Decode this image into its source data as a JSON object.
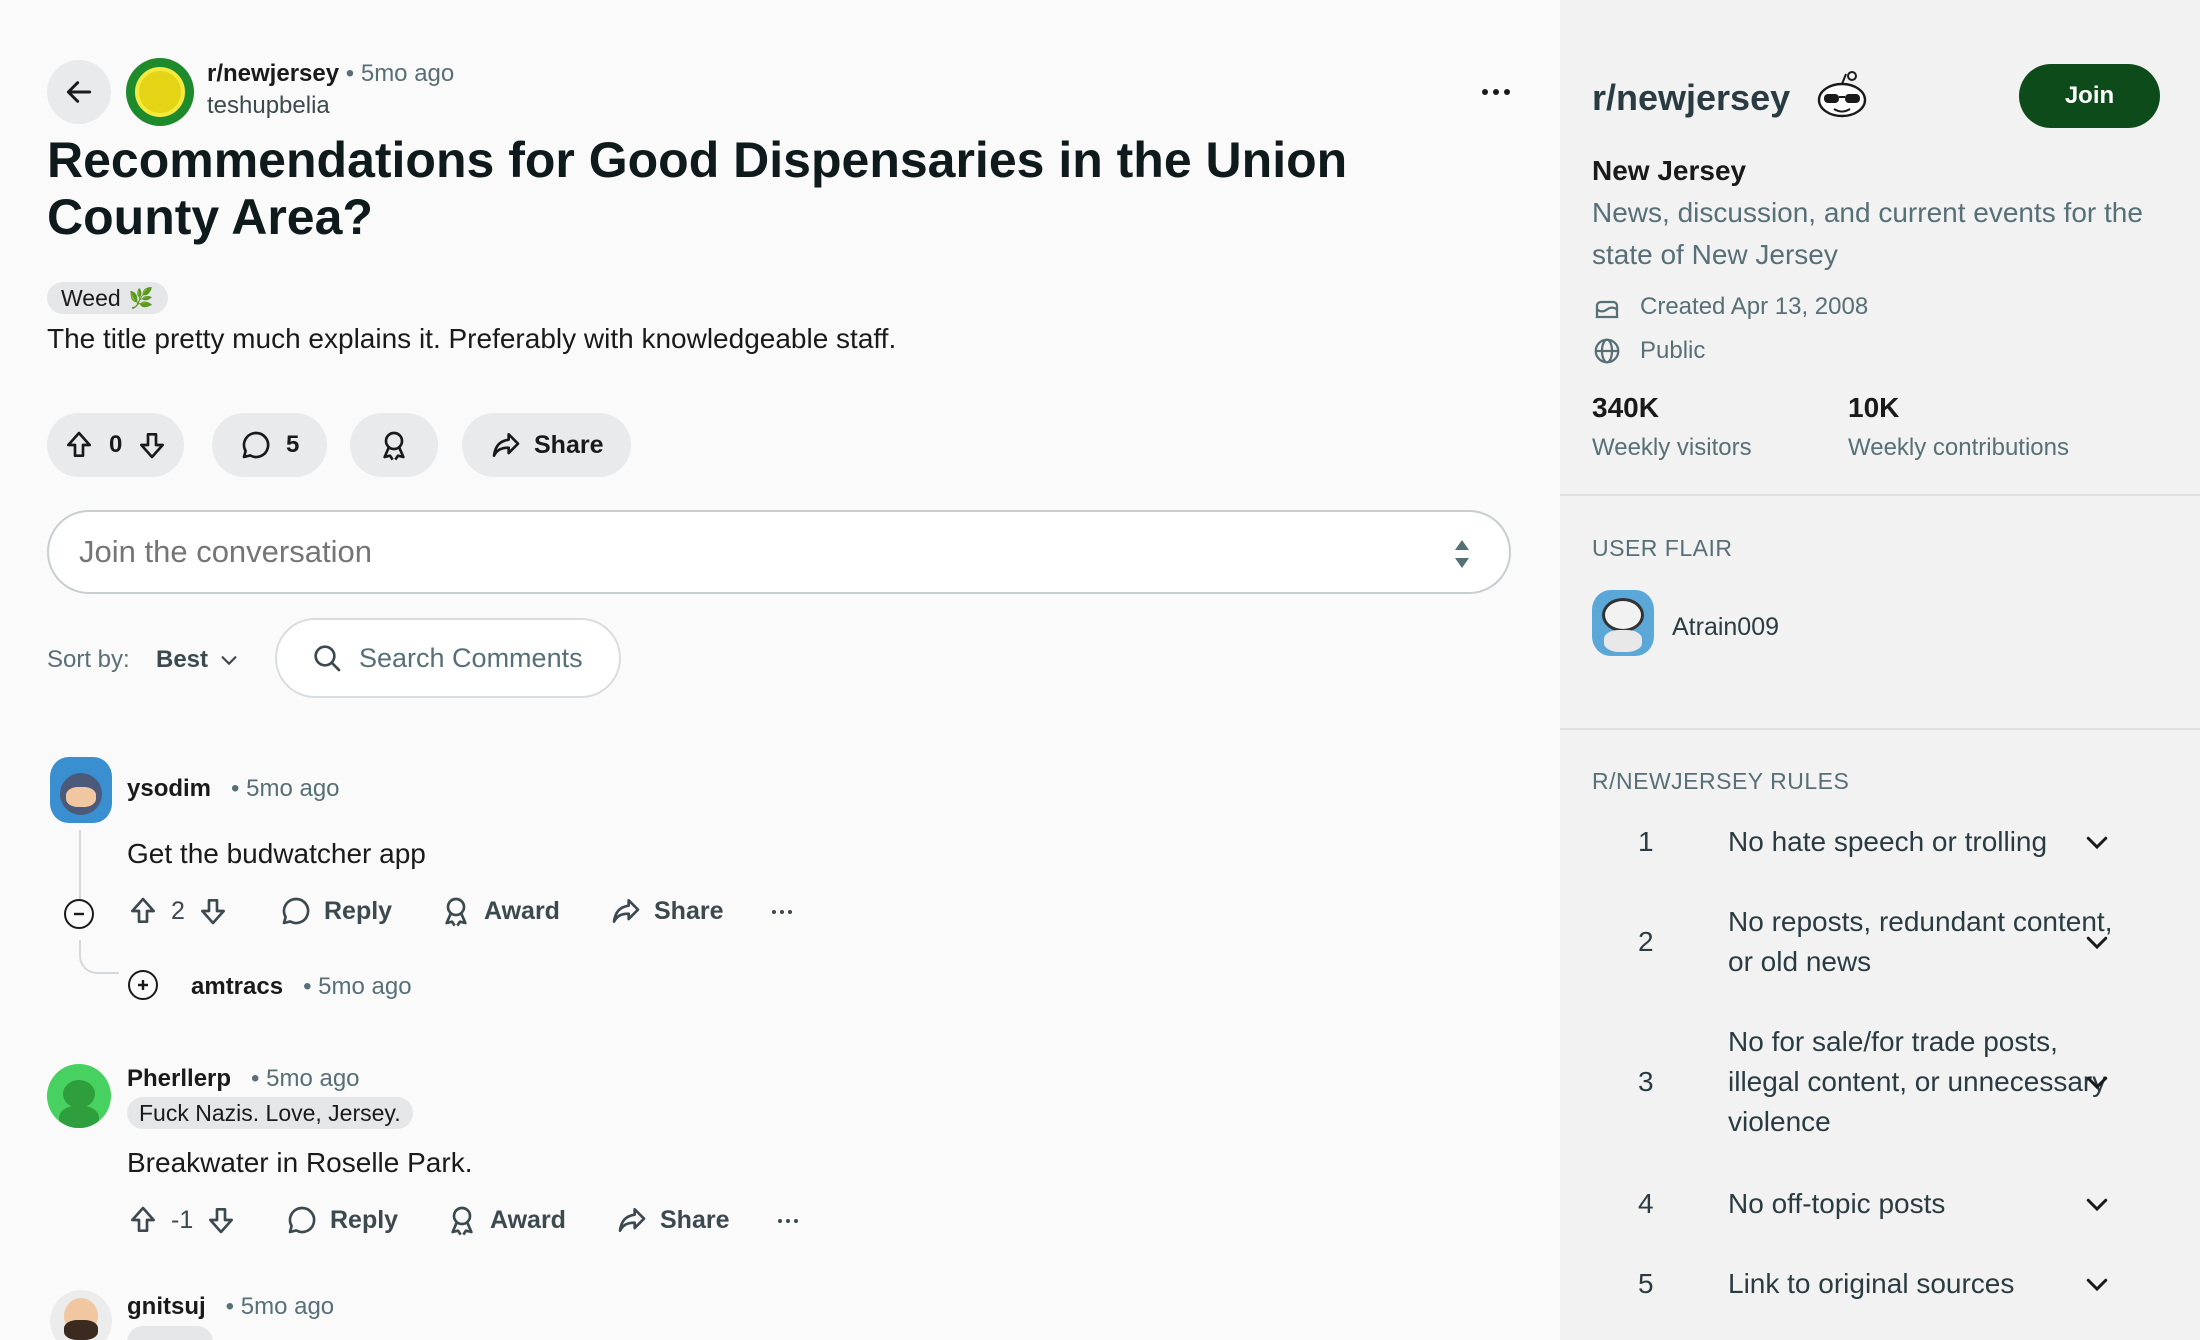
{
  "post": {
    "subreddit": "r/newjersey",
    "time": "5mo ago",
    "author": "teshupbelia",
    "title": "Recommendations for Good Dispensaries in the Union County Area?",
    "flair": "Weed",
    "body": "The title pretty much explains it. Preferably with knowledgeable staff.",
    "votes": "0",
    "comments": "5",
    "share_label": "Share"
  },
  "composer": {
    "placeholder": "Join the conversation"
  },
  "sort": {
    "label": "Sort by:",
    "value": "Best",
    "search_placeholder": "Search Comments"
  },
  "comments": [
    {
      "author": "ysodim",
      "time": "5mo ago",
      "text": "Get the budwatcher app",
      "votes": "2",
      "reply": "Reply",
      "award": "Award",
      "share": "Share"
    },
    {
      "author": "amtracs",
      "time": "5mo ago"
    },
    {
      "author": "Pherllerp",
      "time": "5mo ago",
      "flair": "Fuck Nazis. Love, Jersey.",
      "text": "Breakwater in Roselle Park.",
      "votes": "-1",
      "reply": "Reply",
      "award": "Award",
      "share": "Share"
    },
    {
      "author": "gnitsuj",
      "time": "5mo ago"
    }
  ],
  "sidebar": {
    "name": "r/newjersey",
    "join": "Join",
    "title": "New Jersey",
    "description": "News, discussion, and current events for the state of New Jersey",
    "created": "Created Apr 13, 2008",
    "visibility": "Public",
    "stats": [
      {
        "value": "340K",
        "label": "Weekly visitors"
      },
      {
        "value": "10K",
        "label": "Weekly contributions"
      }
    ],
    "user_flair_heading": "USER FLAIR",
    "user_flair_name": "Atrain009",
    "rules_heading": "R/NEWJERSEY RULES",
    "rules": [
      {
        "num": "1",
        "text": "No hate speech or trolling"
      },
      {
        "num": "2",
        "text": "No reposts, redundant content, or old news"
      },
      {
        "num": "3",
        "text": "No for sale/for trade posts, illegal content, or unnecessary violence"
      },
      {
        "num": "4",
        "text": "No off-topic posts"
      },
      {
        "num": "5",
        "text": "Link to original sources"
      }
    ]
  },
  "colors": {
    "join_bg": "#0e4b1a",
    "avatar_green": "#46d160",
    "pill_bg": "#e9eaeb"
  }
}
